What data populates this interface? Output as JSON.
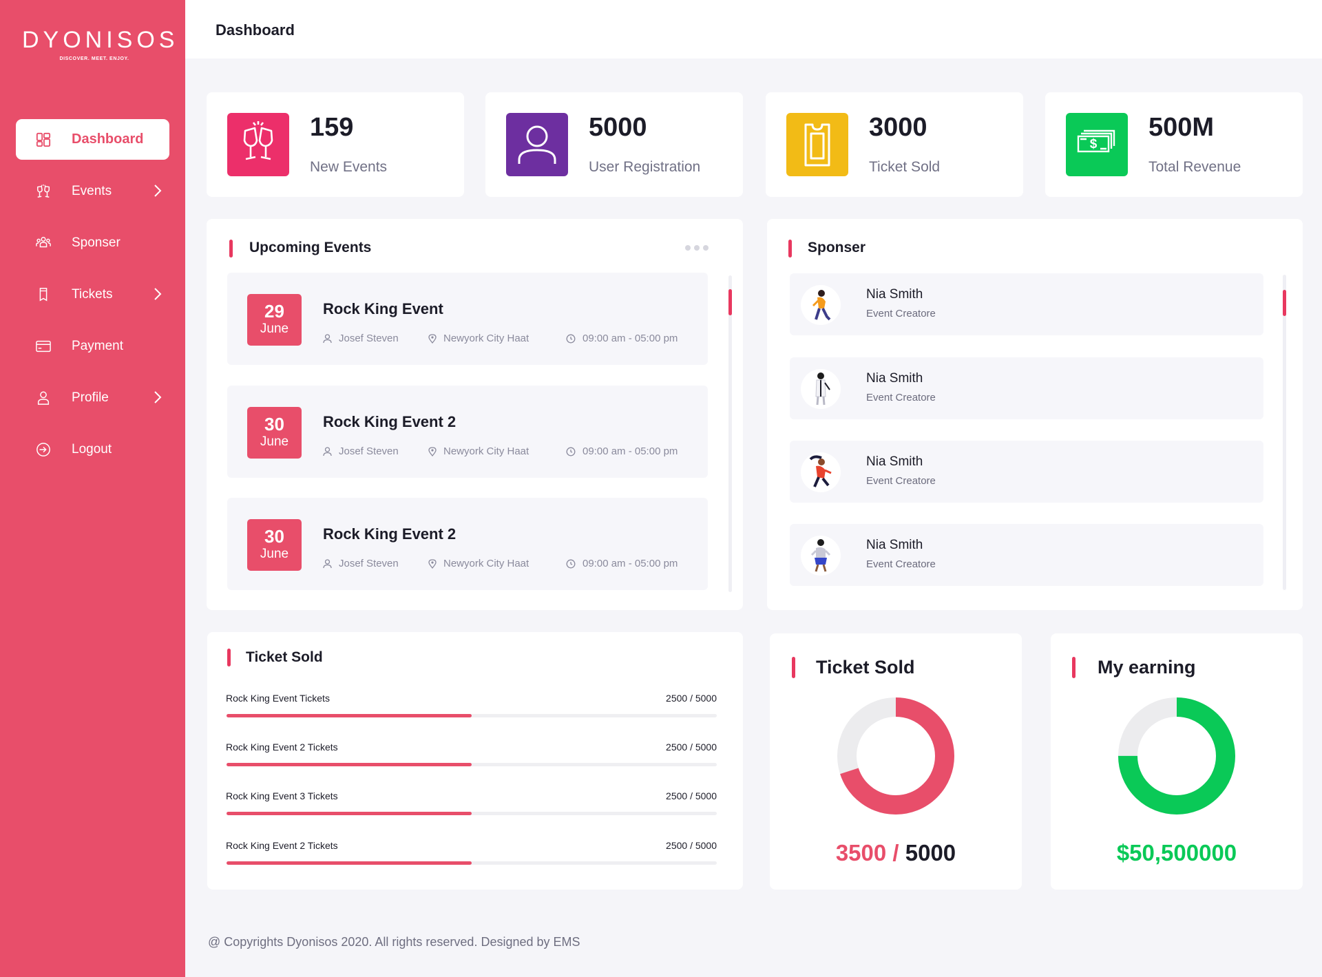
{
  "brand": {
    "name": "DYONISOS",
    "tagline": "DISCOVER. MEET. ENJOY."
  },
  "colors": {
    "accent": "#e84e6a",
    "pink": "#ec2f6a",
    "purple": "#6d2fa0",
    "yellow": "#f2bb16",
    "green": "#0ac957"
  },
  "sidebar": {
    "items": [
      {
        "label": "Dashboard",
        "icon": "dashboard-grid-icon",
        "active": true
      },
      {
        "label": "Events",
        "icon": "cheers-glasses-icon",
        "has_submenu": true
      },
      {
        "label": "Sponser",
        "icon": "group-people-icon"
      },
      {
        "label": "Tickets",
        "icon": "ticket-icon",
        "has_submenu": true
      },
      {
        "label": "Payment",
        "icon": "credit-card-icon"
      },
      {
        "label": "Profile",
        "icon": "user-icon",
        "has_submenu": true
      },
      {
        "label": "Logout",
        "icon": "logout-icon"
      }
    ]
  },
  "header": {
    "title": "Dashboard"
  },
  "stats": [
    {
      "value": "159",
      "label": "New Events",
      "icon": "cheers-glasses-icon",
      "color": "#ec2f6a"
    },
    {
      "value": "5000",
      "label": "User Registration",
      "icon": "user-icon",
      "color": "#6d2fa0"
    },
    {
      "value": "3000",
      "label": "Ticket Sold",
      "icon": "ticket-icon",
      "color": "#f2bb16"
    },
    {
      "value": "500M",
      "label": "Total Revenue",
      "icon": "money-icon",
      "color": "#0ac957"
    }
  ],
  "upcoming": {
    "title": "Upcoming Events",
    "events": [
      {
        "day": "29",
        "month": "June",
        "title": "Rock King Event",
        "organizer": "Josef Steven",
        "location": "Newyork City Haat",
        "time": "09:00 am - 05:00 pm"
      },
      {
        "day": "30",
        "month": "June",
        "title": "Rock King Event 2",
        "organizer": "Josef Steven",
        "location": "Newyork City Haat",
        "time": "09:00 am - 05:00 pm"
      },
      {
        "day": "30",
        "month": "June",
        "title": "Rock King Event 2",
        "organizer": "Josef Steven",
        "location": "Newyork City Haat",
        "time": "09:00 am - 05:00 pm"
      }
    ]
  },
  "sponsors": {
    "title": "Sponser",
    "items": [
      {
        "name": "Nia Smith",
        "role": "Event Creatore"
      },
      {
        "name": "Nia Smith",
        "role": "Event Creatore"
      },
      {
        "name": "Nia Smith",
        "role": "Event Creatore"
      },
      {
        "name": "Nia Smith",
        "role": "Event Creatore"
      }
    ]
  },
  "ticket_progress": {
    "title": "Ticket Sold",
    "rows": [
      {
        "label": "Rock King Event Tickets",
        "count": "2500 / 5000",
        "fraction": 0.5
      },
      {
        "label": "Rock King Event 2 Tickets",
        "count": "2500 / 5000",
        "fraction": 0.5
      },
      {
        "label": "Rock King Event 3 Tickets",
        "count": "2500 / 5000",
        "fraction": 0.5
      },
      {
        "label": "Rock King Event 2 Tickets",
        "count": "2500 / 5000",
        "fraction": 0.5
      }
    ]
  },
  "ticket_donut": {
    "title": "Ticket Sold",
    "sold": "3500",
    "sep": "/",
    "total": "5000",
    "fraction": 0.7
  },
  "earning_donut": {
    "title": "My earning",
    "value": "$50,500000",
    "fraction": 0.75
  },
  "footer": {
    "text": "@ Copyrights Dyonisos 2020. All rights reserved. Designed by EMS"
  }
}
